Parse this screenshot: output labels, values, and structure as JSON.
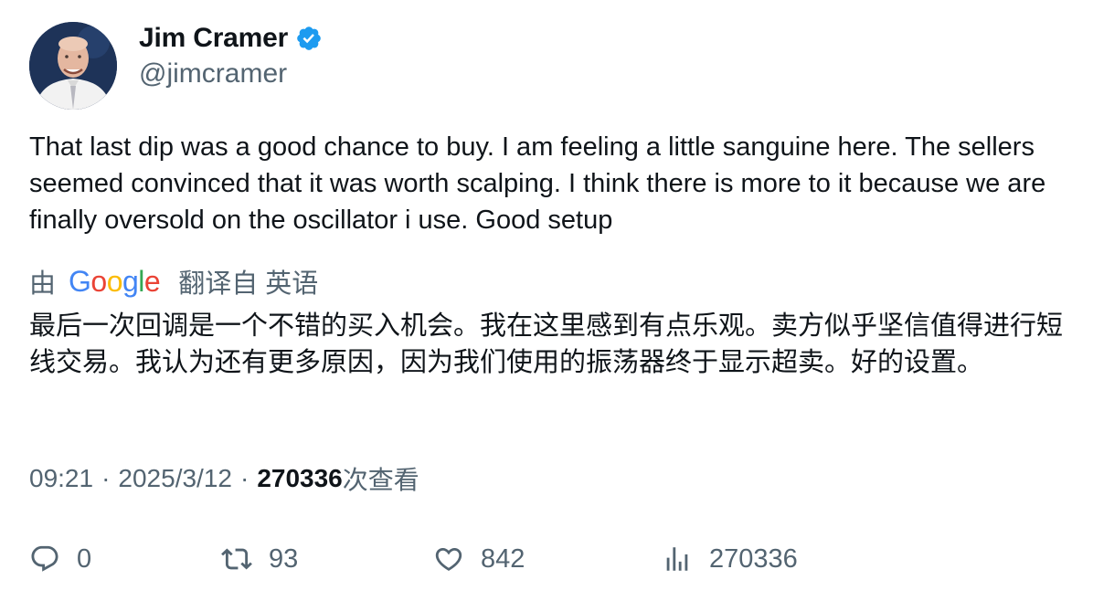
{
  "author": {
    "name": "Jim Cramer",
    "handle": "@jimcramer",
    "verified": true,
    "verified_color": "#1d9bf0"
  },
  "tweet": {
    "text": "That last dip was a good chance to buy. I am feeling a little sanguine here. The sellers seemed convinced that it was worth scalping. I think there is more to it because we are finally oversold on the oscillator i use. Good setup"
  },
  "translation": {
    "prefix": "由",
    "service": "Google",
    "suffix": "翻译自 英语",
    "text": "最后一次回调是一个不错的买入机会。我在这里感到有点乐观。卖方似乎坚信值得进行短线交易。我认为还有更多原因，因为我们使用的振荡器终于显示超卖。好的设置。"
  },
  "meta": {
    "time": "09:21",
    "date": "2025/3/12",
    "views": "270336",
    "views_label": "次查看"
  },
  "actions": {
    "replies": "0",
    "retweets": "93",
    "likes": "842",
    "views": "270336"
  },
  "icons": {
    "verified": "verified-badge-icon",
    "reply": "reply-icon",
    "retweet": "retweet-icon",
    "like": "heart-icon",
    "views": "bar-chart-icon"
  }
}
